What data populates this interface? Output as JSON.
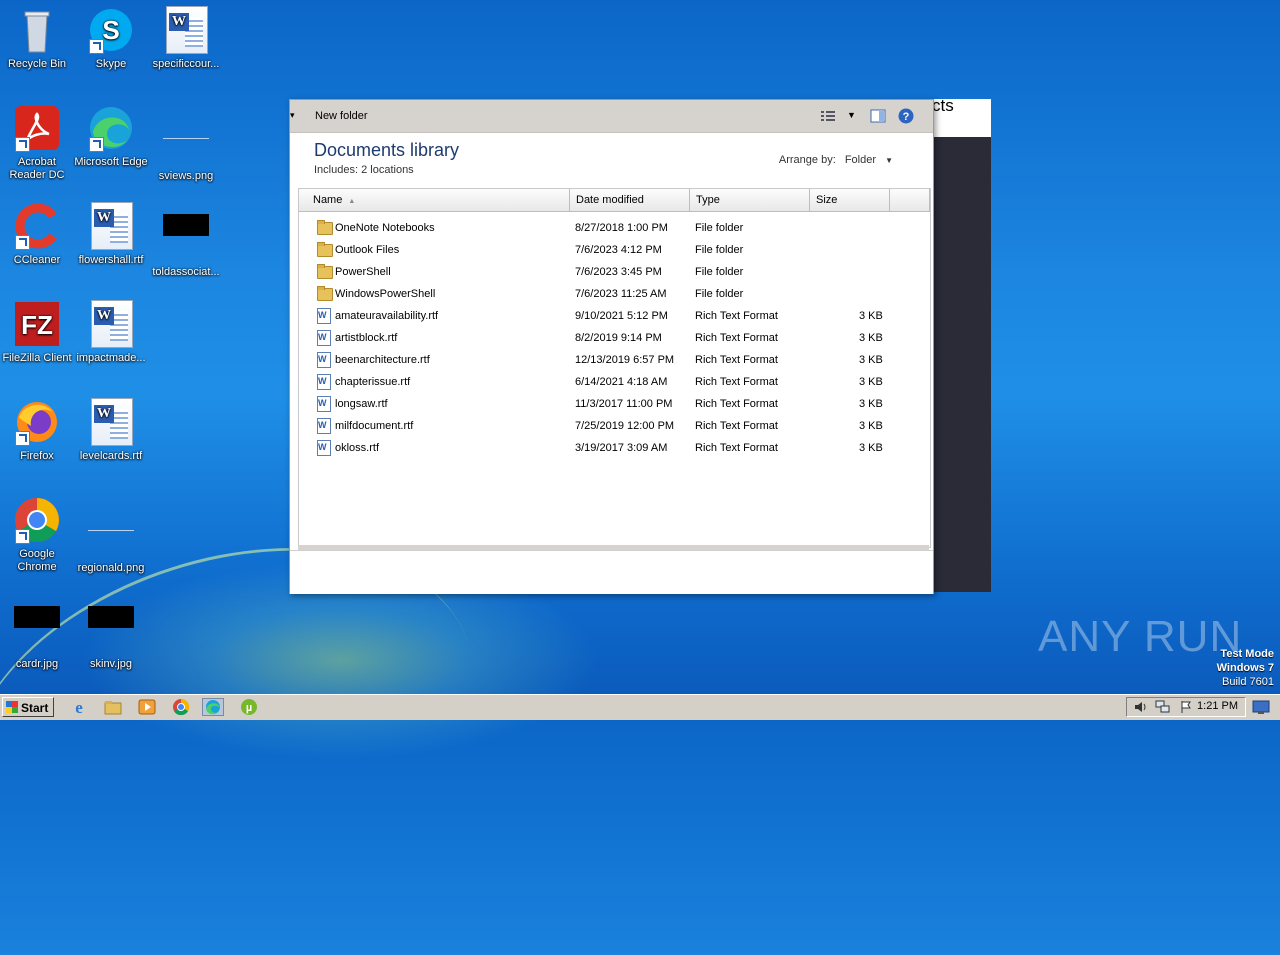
{
  "desktop": {
    "icons": [
      {
        "label": "Recycle Bin",
        "icon": "recycle-bin-icon"
      },
      {
        "label": "Skype",
        "icon": "skype-icon"
      },
      {
        "label": "specificcour...",
        "icon": "word-doc-icon"
      },
      {
        "label": "Acrobat Reader DC",
        "icon": "acrobat-icon"
      },
      {
        "label": "Microsoft Edge",
        "icon": "edge-icon"
      },
      {
        "label": "sviews.png",
        "icon": "png-file-icon"
      },
      {
        "label": "CCleaner",
        "icon": "ccleaner-icon"
      },
      {
        "label": "flowershall.rtf",
        "icon": "word-doc-icon"
      },
      {
        "label": "toldassociat...",
        "icon": "image-file-icon"
      },
      {
        "label": "FileZilla Client",
        "icon": "filezilla-icon"
      },
      {
        "label": "impactmade...",
        "icon": "word-doc-icon"
      },
      {
        "label": "Firefox",
        "icon": "firefox-icon"
      },
      {
        "label": "levelcards.rtf",
        "icon": "word-doc-icon"
      },
      {
        "label": "Google Chrome",
        "icon": "chrome-icon"
      },
      {
        "label": "regionald.png",
        "icon": "png-file-icon"
      },
      {
        "label": "cardr.jpg",
        "icon": "image-file-icon"
      },
      {
        "label": "skinv.jpg",
        "icon": "image-file-icon"
      }
    ]
  },
  "explorer": {
    "toolbar": {
      "new_folder": "New folder",
      "icons": [
        "view-options-icon",
        "preview-pane-icon",
        "help-icon"
      ]
    },
    "header": {
      "title": "Documents library",
      "includes_label": "Includes:",
      "includes_link": "2 locations",
      "arrange_label": "Arrange by:",
      "arrange_value": "Folder"
    },
    "columns": [
      "Name",
      "Date modified",
      "Type",
      "Size"
    ],
    "files": [
      {
        "name": "OneNote Notebooks",
        "date": "8/27/2018 1:00 PM",
        "type": "File folder",
        "size": "",
        "kind": "folder"
      },
      {
        "name": "Outlook Files",
        "date": "7/6/2023 4:12 PM",
        "type": "File folder",
        "size": "",
        "kind": "folder"
      },
      {
        "name": "PowerShell",
        "date": "7/6/2023 3:45 PM",
        "type": "File folder",
        "size": "",
        "kind": "folder"
      },
      {
        "name": "WindowsPowerShell",
        "date": "7/6/2023 11:25 AM",
        "type": "File folder",
        "size": "",
        "kind": "folder"
      },
      {
        "name": "amateuravailability.rtf",
        "date": "9/10/2021 5:12 PM",
        "type": "Rich Text Format",
        "size": "3 KB",
        "kind": "rtf"
      },
      {
        "name": "artistblock.rtf",
        "date": "8/2/2019 9:14 PM",
        "type": "Rich Text Format",
        "size": "3 KB",
        "kind": "rtf"
      },
      {
        "name": "beenarchitecture.rtf",
        "date": "12/13/2019 6:57 PM",
        "type": "Rich Text Format",
        "size": "3 KB",
        "kind": "rtf"
      },
      {
        "name": "chapterissue.rtf",
        "date": "6/14/2021 4:18 AM",
        "type": "Rich Text Format",
        "size": "3 KB",
        "kind": "rtf"
      },
      {
        "name": "longsaw.rtf",
        "date": "11/3/2017 11:00 PM",
        "type": "Rich Text Format",
        "size": "3 KB",
        "kind": "rtf"
      },
      {
        "name": "milfdocument.rtf",
        "date": "7/25/2019 12:00 PM",
        "type": "Rich Text Format",
        "size": "3 KB",
        "kind": "rtf"
      },
      {
        "name": "okloss.rtf",
        "date": "3/19/2017 3:09 AM",
        "type": "Rich Text Format",
        "size": "3 KB",
        "kind": "rtf"
      }
    ]
  },
  "background_window": {
    "text": "cts"
  },
  "watermark": {
    "brand": "ANY RUN",
    "line1": "Test Mode",
    "line2": "Windows 7",
    "line3": "Build 7601"
  },
  "taskbar": {
    "start_label": "Start",
    "apps": [
      "ie-icon",
      "explorer-icon",
      "media-player-icon",
      "chrome-icon",
      "edge-icon",
      "utorrent-icon"
    ],
    "clock": "1:21 PM"
  }
}
